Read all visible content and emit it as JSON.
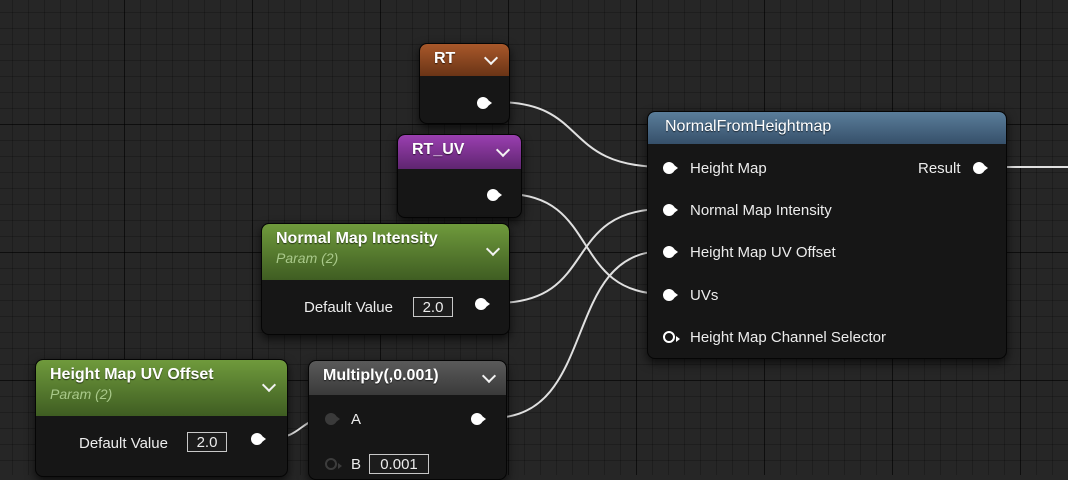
{
  "graph": {
    "accent_colors": {
      "texture_param": "#8a4620",
      "uv_param": "#7e2f92",
      "scalar_param": "#5a8030",
      "math": "#4a4a4a",
      "function": "#4a6884",
      "wire": "#e0e0e0"
    },
    "nodes": {
      "rt": {
        "title": "RT"
      },
      "rt_uv": {
        "title": "RT_UV"
      },
      "nmi": {
        "title": "Normal Map Intensity",
        "subtitle": "Param (2)",
        "default_label": "Default Value",
        "default_value": "2.0"
      },
      "hmuv": {
        "title": "Height Map UV Offset",
        "subtitle": "Param (2)",
        "default_label": "Default Value",
        "default_value": "2.0"
      },
      "multiply": {
        "title": "Multiply(,0.001)",
        "input_a": "A",
        "input_b": "B",
        "b_value": "0.001"
      },
      "nfh": {
        "title": "NormalFromHeightmap",
        "inputs": [
          "Height Map",
          "Normal Map Intensity",
          "Height Map UV Offset",
          "UVs",
          "Height Map Channel Selector"
        ],
        "output": "Result"
      }
    }
  }
}
